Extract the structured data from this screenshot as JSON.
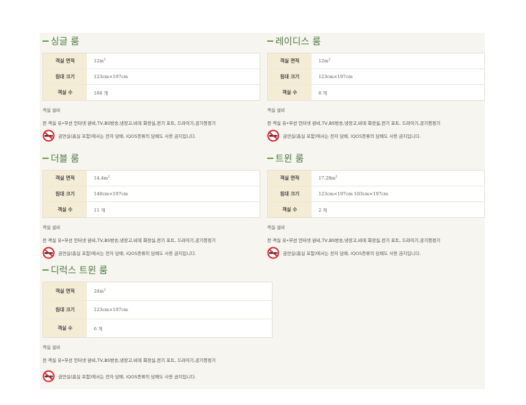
{
  "rooms": [
    {
      "title": "싱글 룸",
      "area_label": "객실 면적",
      "area": "12m",
      "area_sup": "2",
      "bed_label": "침대 크기",
      "bed": "123cm×197cm",
      "count_label": "객실 수",
      "count": "184 개",
      "amenities_title": "객실 설비",
      "amenities": "전 객실 유•무선 인터넷 완비,TV,BS방송,냉장고,비데 화장실,전기 포트, 드라이기,공기청정기",
      "notice": "금연실(흡실 포함)에서는 전자 담배, IQOS종류의 담배도 사용 금지입니다.",
      "icon": "no-smoking-icon"
    },
    {
      "title": "레이디스 룸",
      "area_label": "객실 면적",
      "area": "12m",
      "area_sup": "2",
      "bed_label": "침대 크기",
      "bed": "123cm×197cm",
      "count_label": "객실 수",
      "count": "8 개",
      "amenities_title": "객실 설비",
      "amenities": "전 객실 유•무선 인터넷 완비,TV,BS방송,냉장고,비데 화장실,전기 포트, 드라이기,공기청정기",
      "notice": "금연실(흡실 포함)에서는 전자 담배, IQOS종류의 담배도 사용 금지입니다.",
      "icon": "no-smoking-icon"
    },
    {
      "title": "더블 룸",
      "area_label": "객실 면적",
      "area": "14.4m",
      "area_sup": "2",
      "bed_label": "침대 크기",
      "bed": "140cm×197cm",
      "count_label": "객실 수",
      "count": "11 개",
      "amenities_title": "객실 설비",
      "amenities": "전 객실 유•무선 인터넷 완비,TV,BS방송,냉장고,비데 화장실,전기 포트, 드라이기,공기청정기",
      "notice": "금연실(흡실 포함)에서는 전자 담배, IQOS종류의 담배도 사용 금지입니다.",
      "icon": "no-smoking-icon"
    },
    {
      "title": "트윈 룸",
      "area_label": "객실 면적",
      "area": "17.28m",
      "area_sup": "2",
      "bed_label": "침대 크기",
      "bed": "123cm×197cm 103cm×197cm",
      "count_label": "객실 수",
      "count": "2 개",
      "amenities_title": "객실 설비",
      "amenities": "전 객실 유•무선 인터넷 완비,TV,BS방송,냉장고,비데 화장실,전기 포트, 드라이기,공기청정기",
      "notice": "금연실(흡실 포함)에서는 전자 담배, IQOS종류의 담배도 사용 금지입니다.",
      "icon": "no-smoking-icon"
    },
    {
      "title": "디럭스 트윈 룸",
      "area_label": "객실 면적",
      "area": "24m",
      "area_sup": "2",
      "bed_label": "침대 크기",
      "bed": "123cm×197cm",
      "count_label": "객실 수",
      "count": "6 개",
      "amenities_title": "객실 설비",
      "amenities": "전 객실 유•무선 인터넷 완비,TV,BS방송,냉장고,비데 화장실,전기 포트, 드라이기,공기청정기",
      "notice": "금연실(흡실 포함)에서는 전자 담배, IQOS종류의 담배도 사용 금지입니다.",
      "icon": "no-smoking-icon"
    }
  ],
  "colors": {
    "title_green": "#4a7a3c",
    "label_bg": "#f5ecd6",
    "icon_red": "#d9242b",
    "panel_bg": "#f7f5f0"
  }
}
